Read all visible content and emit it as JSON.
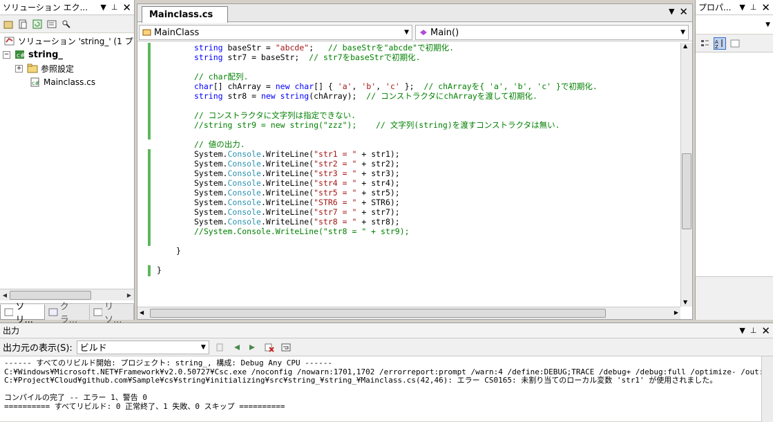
{
  "solution_explorer": {
    "title": "ソリューション エク...",
    "nodes": [
      {
        "label": "ソリューション 'string_' (1 プ"
      },
      {
        "label": "string_"
      },
      {
        "label": "参照設定"
      },
      {
        "label": "Mainclass.cs"
      }
    ],
    "tabs": [
      "ソリ...",
      "クラ...",
      "リソ..."
    ]
  },
  "editor": {
    "tab": "Mainclass.cs",
    "class_dropdown": "MainClass",
    "member_dropdown": "Main()"
  },
  "code_lines": [
    [
      [
        "kw",
        "string"
      ],
      [
        "p",
        " baseStr = "
      ],
      [
        "str",
        "\"abcde\""
      ],
      [
        "p",
        ";   "
      ],
      [
        "cm",
        "// baseStrを\"abcde\"で初期化."
      ]
    ],
    [
      [
        "kw",
        "string"
      ],
      [
        "p",
        " str7 = baseStr;  "
      ],
      [
        "cm",
        "// str7をbaseStrで初期化."
      ]
    ],
    [],
    [
      [
        "cm",
        "// char配列."
      ]
    ],
    [
      [
        "kw",
        "char"
      ],
      [
        "p",
        "[] chArray = "
      ],
      [
        "kw",
        "new"
      ],
      [
        "p",
        " "
      ],
      [
        "kw",
        "char"
      ],
      [
        "p",
        "[] { "
      ],
      [
        "str",
        "'a'"
      ],
      [
        "p",
        ", "
      ],
      [
        "str",
        "'b'"
      ],
      [
        "p",
        ", "
      ],
      [
        "str",
        "'c'"
      ],
      [
        "p",
        " };  "
      ],
      [
        "cm",
        "// chArrayを{ 'a', 'b', 'c' }で初期化."
      ]
    ],
    [
      [
        "kw",
        "string"
      ],
      [
        "p",
        " str8 = "
      ],
      [
        "kw",
        "new"
      ],
      [
        "p",
        " "
      ],
      [
        "kw",
        "string"
      ],
      [
        "p",
        "(chArray);  "
      ],
      [
        "cm",
        "// コンストラクタにchArrayを渡して初期化."
      ]
    ],
    [],
    [
      [
        "cm",
        "// コンストラクタに文字列は指定できない."
      ]
    ],
    [
      [
        "cm",
        "//string str9 = new string(\"zzz\");    // 文字列(string)を渡すコンストラクタは無い."
      ]
    ],
    [],
    [
      [
        "cm",
        "// 値の出力."
      ]
    ],
    [
      [
        "p",
        "System."
      ],
      [
        "ty",
        "Console"
      ],
      [
        "p",
        ".WriteLine("
      ],
      [
        "str",
        "\"str1 = \""
      ],
      [
        "p",
        " + str1);"
      ]
    ],
    [
      [
        "p",
        "System."
      ],
      [
        "ty",
        "Console"
      ],
      [
        "p",
        ".WriteLine("
      ],
      [
        "str",
        "\"str2 = \""
      ],
      [
        "p",
        " + str2);"
      ]
    ],
    [
      [
        "p",
        "System."
      ],
      [
        "ty",
        "Console"
      ],
      [
        "p",
        ".WriteLine("
      ],
      [
        "str",
        "\"str3 = \""
      ],
      [
        "p",
        " + str3);"
      ]
    ],
    [
      [
        "p",
        "System."
      ],
      [
        "ty",
        "Console"
      ],
      [
        "p",
        ".WriteLine("
      ],
      [
        "str",
        "\"str4 = \""
      ],
      [
        "p",
        " + str4);"
      ]
    ],
    [
      [
        "p",
        "System."
      ],
      [
        "ty",
        "Console"
      ],
      [
        "p",
        ".WriteLine("
      ],
      [
        "str",
        "\"str5 = \""
      ],
      [
        "p",
        " + str5);"
      ]
    ],
    [
      [
        "p",
        "System."
      ],
      [
        "ty",
        "Console"
      ],
      [
        "p",
        ".WriteLine("
      ],
      [
        "str",
        "\"STR6 = \""
      ],
      [
        "p",
        " + STR6);"
      ]
    ],
    [
      [
        "p",
        "System."
      ],
      [
        "ty",
        "Console"
      ],
      [
        "p",
        ".WriteLine("
      ],
      [
        "str",
        "\"str7 = \""
      ],
      [
        "p",
        " + str7);"
      ]
    ],
    [
      [
        "p",
        "System."
      ],
      [
        "ty",
        "Console"
      ],
      [
        "p",
        ".WriteLine("
      ],
      [
        "str",
        "\"str8 = \""
      ],
      [
        "p",
        " + str8);"
      ]
    ],
    [
      [
        "cm",
        "//System.Console.WriteLine(\"str8 = \" + str9);"
      ]
    ],
    [],
    [
      [
        "p",
        "}"
      ]
    ],
    [],
    [
      [
        "p",
        "}"
      ]
    ]
  ],
  "properties": {
    "title": "プロパ..."
  },
  "output": {
    "title": "出力",
    "source_label": "出力元の表示(S):",
    "source_value": "ビルド",
    "lines": [
      "------ すべてのリビルド開始: プロジェクト: string_, 構成: Debug Any CPU ------",
      "C:¥Windows¥Microsoft.NET¥Framework¥v2.0.50727¥Csc.exe /noconfig /nowarn:1701,1702 /errorreport:prompt /warn:4 /define:DEBUG;TRACE /debug+ /debug:full /optimize- /out:obj¥Debug¥string_",
      "C:¥Project¥Cloud¥github.com¥Sample¥cs¥string¥initializing¥src¥string_¥string_¥Mainclass.cs(42,46): エラー CS0165: 未割り当てのローカル変数 'str1' が使用されました。",
      "",
      "コンパイルの完了 -- エラー 1、警告 0",
      "========== すべてリビルド: 0 正常終了、1 失敗、0 スキップ =========="
    ]
  }
}
